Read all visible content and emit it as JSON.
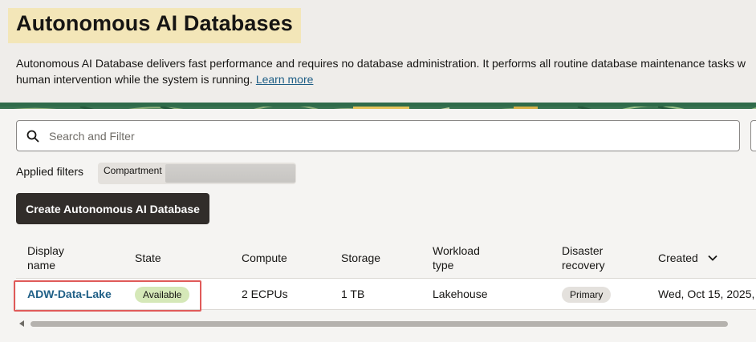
{
  "page": {
    "title": "Autonomous AI Databases",
    "description_line1": "Autonomous AI Database delivers fast performance and requires no database administration. It performs all routine database maintenance tasks w",
    "description_line2": "human intervention while the system is running.",
    "learn_more": "Learn more"
  },
  "search": {
    "placeholder": "Search and Filter",
    "icon": "search-icon"
  },
  "filters": {
    "label": "Applied filters",
    "chip_label": "Compartment"
  },
  "create_button": "Create Autonomous AI Database",
  "table": {
    "headers": {
      "display_name_1": "Display",
      "display_name_2": "name",
      "state": "State",
      "compute": "Compute",
      "storage": "Storage",
      "workload_1": "Workload",
      "workload_2": "type",
      "dr_1": "Disaster",
      "dr_2": "recovery",
      "created": "Created"
    },
    "rows": [
      {
        "display_name": "ADW-Data-Lake",
        "state": "Available",
        "compute": "2 ECPUs",
        "storage": "1 TB",
        "workload_type": "Lakehouse",
        "disaster_recovery": "Primary",
        "created": "Wed, Oct 15, 2025,"
      }
    ]
  },
  "colors": {
    "title_highlight": "#f3e6b8",
    "link": "#1f5f86",
    "primary_button": "#312d2a",
    "available_badge": "#d5e8b8",
    "highlight_box": "#e05a59"
  }
}
